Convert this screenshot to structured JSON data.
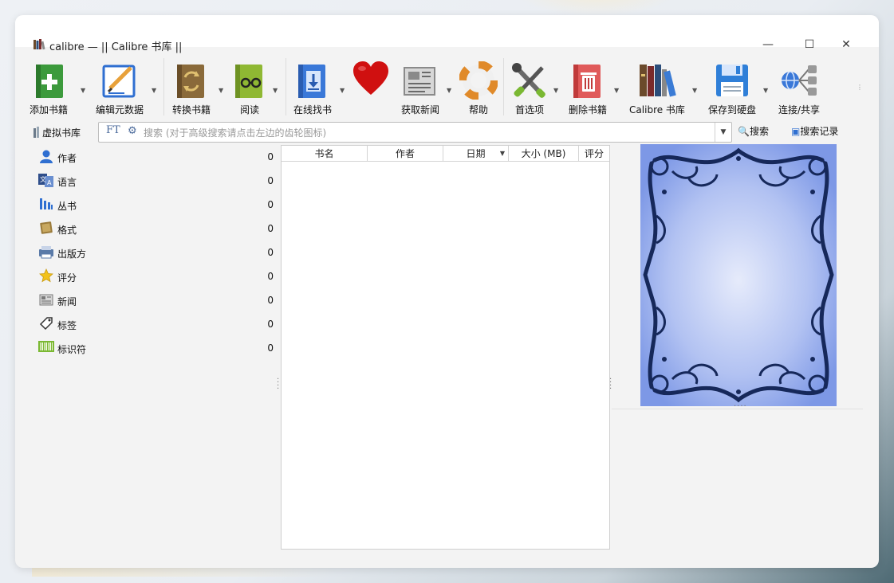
{
  "window": {
    "title": "calibre — || Calibre 书库 ||",
    "minimize_glyph": "—",
    "maximize_glyph": "☐",
    "close_glyph": "✕"
  },
  "toolbar": [
    {
      "label": "添加书籍",
      "icon": "add-book-icon",
      "dropdown": true
    },
    {
      "label": "编辑元数据",
      "icon": "edit-metadata-icon",
      "dropdown": true
    },
    {
      "label": "转换书籍",
      "icon": "convert-book-icon",
      "dropdown": true
    },
    {
      "label": "阅读",
      "icon": "read-book-icon",
      "dropdown": true
    },
    {
      "label": "在线找书",
      "icon": "download-book-icon",
      "dropdown": true
    },
    {
      "label": "",
      "icon": "heart-icon",
      "dropdown": false
    },
    {
      "label": "获取新闻",
      "icon": "news-icon",
      "dropdown": true
    },
    {
      "label": "帮助",
      "icon": "help-lifebuoy-icon",
      "dropdown": false
    },
    {
      "label": "首选项",
      "icon": "preferences-tools-icon",
      "dropdown": true
    },
    {
      "label": "删除书籍",
      "icon": "delete-book-icon",
      "dropdown": true
    },
    {
      "label": "Calibre 书库",
      "icon": "library-books-icon",
      "dropdown": true
    },
    {
      "label": "保存到硬盘",
      "icon": "save-disk-icon",
      "dropdown": true
    },
    {
      "label": "连接/共享",
      "icon": "connect-share-icon",
      "dropdown": false
    }
  ],
  "search": {
    "virtual_library": "虚拟书库",
    "placeholder": "搜索 (对于高级搜索请点击左边的齿轮图标)",
    "search_button": "搜索",
    "history_button": "搜索记录",
    "ft_glyph": "FT"
  },
  "tag_browser": [
    {
      "label": "作者",
      "count": "0",
      "icon": "author-icon"
    },
    {
      "label": "语言",
      "count": "0",
      "icon": "language-icon"
    },
    {
      "label": "丛书",
      "count": "0",
      "icon": "series-icon"
    },
    {
      "label": "格式",
      "count": "0",
      "icon": "format-icon"
    },
    {
      "label": "出版方",
      "count": "0",
      "icon": "publisher-icon"
    },
    {
      "label": "评分",
      "count": "0",
      "icon": "rating-star-icon"
    },
    {
      "label": "新闻",
      "count": "0",
      "icon": "news-icon"
    },
    {
      "label": "标签",
      "count": "0",
      "icon": "tag-icon"
    },
    {
      "label": "标识符",
      "count": "0",
      "icon": "identifier-barcode-icon"
    }
  ],
  "book_list": {
    "columns": [
      "书名",
      "作者",
      "日期",
      "大小 (MB)",
      "评分"
    ],
    "sorted_column": "日期"
  },
  "colors": {
    "cover_border": "#1a2d5a",
    "cover_fill": "#a9baf0",
    "accent_blue": "#2f6fd1"
  }
}
